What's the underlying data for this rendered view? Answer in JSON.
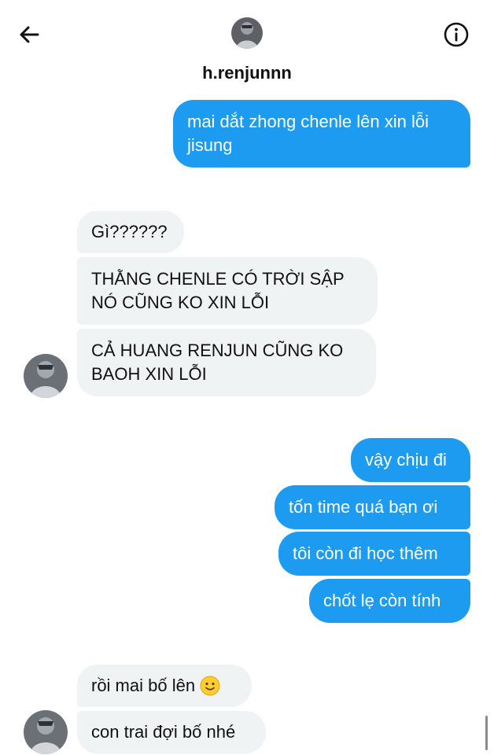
{
  "header": {
    "username": "h.renjunnn",
    "back_icon": "arrow-left-icon",
    "info_icon": "info-circle-icon"
  },
  "messages": [
    {
      "dir": "out",
      "text": "mai dắt zhong chenle lên xin lỗi jisung"
    },
    {
      "dir": "in",
      "text": "Gì??????"
    },
    {
      "dir": "in",
      "text": "THẰNG CHENLE CÓ TRỜI SẬP NÓ CŨNG KO XIN LỖI"
    },
    {
      "dir": "in",
      "text": "CẢ HUANG RENJUN CŨNG KO BAOH XIN LỖI"
    },
    {
      "dir": "out",
      "text": "vậy chịu đi"
    },
    {
      "dir": "out",
      "text": "tốn time quá bạn ơi"
    },
    {
      "dir": "out",
      "text": "tôi còn đi học thêm"
    },
    {
      "dir": "out",
      "text": "chốt lẹ còn tính"
    },
    {
      "dir": "in",
      "text": "rồi mai bố lên",
      "emoji": "slightly-smiling-face"
    },
    {
      "dir": "in",
      "text": "con trai đợi bố nhé"
    }
  ],
  "colors": {
    "outgoing_bubble": "#1d9bf0",
    "incoming_bubble": "#eff3f4",
    "outgoing_text": "#ffffff",
    "incoming_text": "#111111"
  }
}
